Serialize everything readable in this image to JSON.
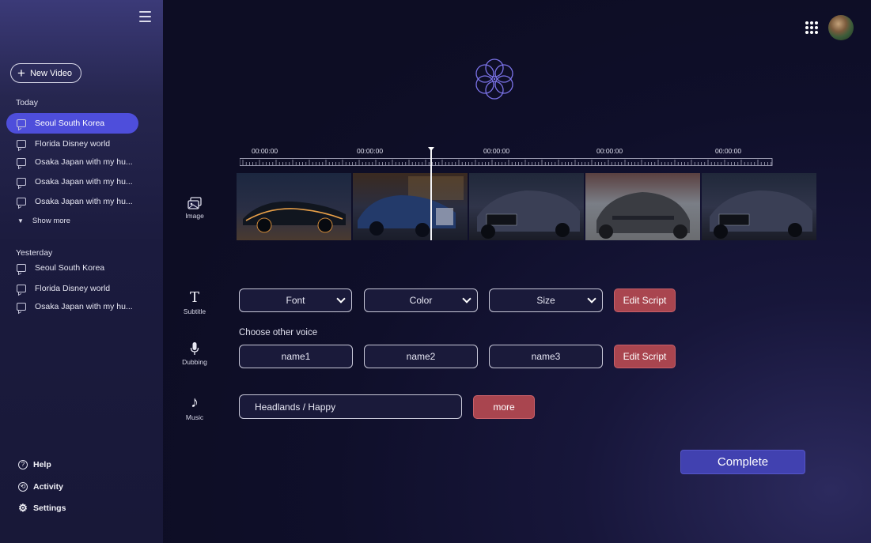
{
  "sidebar": {
    "new_video_label": "New Video",
    "today_label": "Today",
    "today_items": [
      {
        "label": "Seoul South Korea"
      },
      {
        "label": "Florida Disney world"
      },
      {
        "label": "Osaka Japan with my hu..."
      },
      {
        "label": "Osaka Japan with my hu..."
      },
      {
        "label": "Osaka Japan with my hu..."
      }
    ],
    "show_more_label": "Show more",
    "yesterday_label": "Yesterday",
    "yesterday_items": [
      {
        "label": "Seoul South Korea"
      },
      {
        "label": "Florida Disney world"
      },
      {
        "label": "Osaka Japan with my hu..."
      }
    ],
    "bottom": {
      "help": "Help",
      "activity": "Activity",
      "settings": "Settings"
    }
  },
  "timeline": {
    "timecodes": [
      "00:00:00",
      "00:00:00",
      "00:00:00",
      "00:00:00",
      "00:00:00"
    ],
    "frames": [
      {
        "name": "frame-1-concept-car-night",
        "color": "#d08a3a"
      },
      {
        "name": "frame-2-blue-coupe-street",
        "color": "#2c4a8a"
      },
      {
        "name": "frame-3-dark-sedan-front",
        "color": "#3a3f55"
      },
      {
        "name": "frame-4-matte-car-rear",
        "color": "#55585f"
      },
      {
        "name": "frame-5-dark-sedan-front",
        "color": "#3a3f55"
      }
    ]
  },
  "tools": {
    "image": "Image",
    "subtitle": "Subtitle",
    "dubbing": "Dubbing",
    "music": "Music"
  },
  "subtitle_controls": {
    "font": "Font",
    "color": "Color",
    "size": "Size",
    "edit_script": "Edit Script"
  },
  "dubbing_controls": {
    "label": "Choose other voice",
    "voices": [
      "name1",
      "name2",
      "name3"
    ],
    "edit_script": "Edit Script"
  },
  "music_controls": {
    "track": "Headlands / Happy",
    "more": "more"
  },
  "complete_label": "Complete",
  "colors": {
    "accent": "#4e4edb",
    "danger": "#a9454f",
    "complete": "#4141b0",
    "logo": "#7b73e8"
  }
}
